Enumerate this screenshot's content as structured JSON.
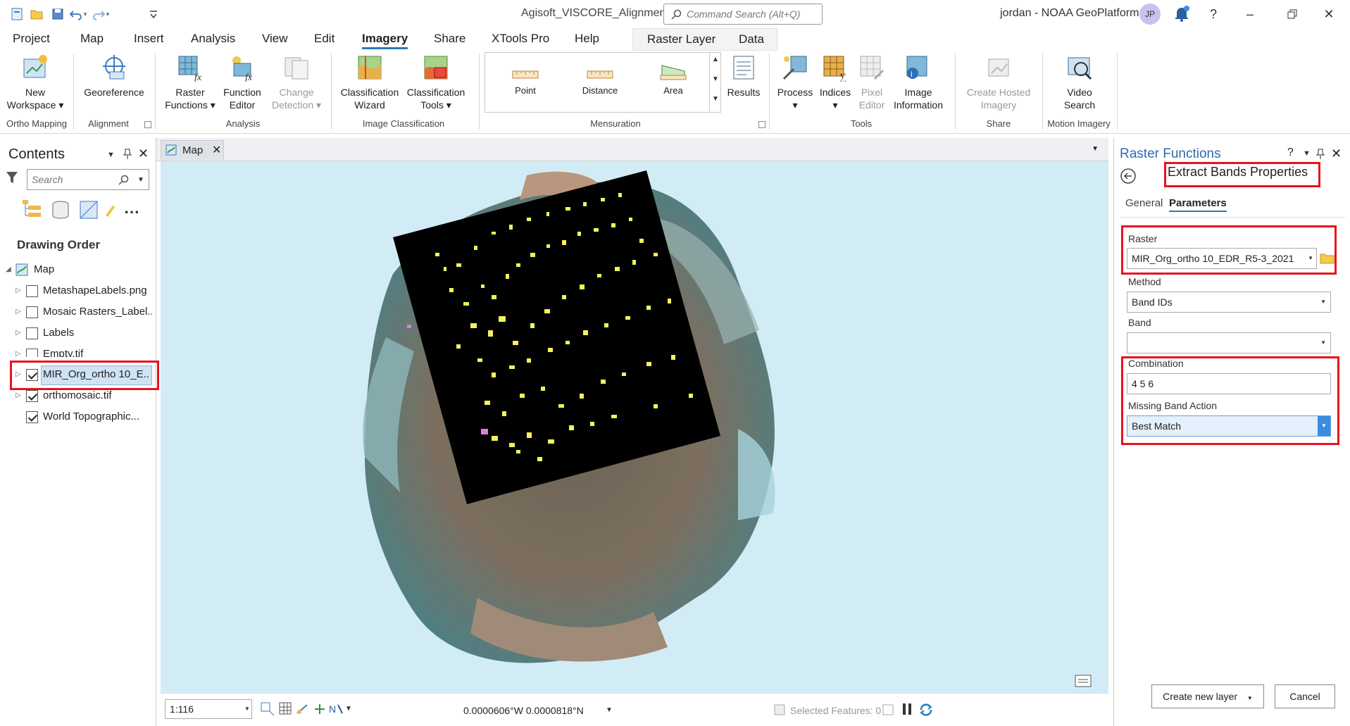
{
  "titlebar": {
    "app_title": "Agisoft_VISCORE_Alignment",
    "command_search_placeholder": "Command Search (Alt+Q)",
    "user": "jordan - NOAA GeoPlatform",
    "avatar_initials": "JP"
  },
  "menu_tabs": [
    "Project",
    "Map",
    "Insert",
    "Analysis",
    "View",
    "Edit",
    "Imagery",
    "Share",
    "XTools Pro",
    "Help"
  ],
  "active_tab": "Imagery",
  "context_tabs": [
    "Raster Layer",
    "Data"
  ],
  "ribbon": {
    "groups": {
      "ortho": "Ortho Mapping",
      "alignment": "Alignment",
      "analysis": "Analysis",
      "image_classification": "Image Classification",
      "mensuration": "Mensuration",
      "tools": "Tools",
      "share": "Share",
      "motion": "Motion Imagery"
    },
    "buttons": {
      "new_workspace": [
        "New",
        "Workspace ▾"
      ],
      "georeference": [
        "Georeference"
      ],
      "raster_functions": [
        "Raster",
        "Functions ▾"
      ],
      "function_editor": [
        "Function",
        "Editor"
      ],
      "change_detection": [
        "Change",
        "Detection ▾"
      ],
      "classification_wizard": [
        "Classification",
        "Wizard"
      ],
      "classification_tools": [
        "Classification",
        "Tools ▾"
      ],
      "results": [
        "Results"
      ],
      "process": [
        "Process",
        "▾"
      ],
      "indices": [
        "Indices",
        "▾"
      ],
      "pixel_editor": [
        "Pixel",
        "Editor"
      ],
      "image_information": [
        "Image",
        "Information"
      ],
      "create_hosted_imagery": [
        "Create Hosted",
        "Imagery"
      ],
      "video_search": [
        "Video",
        "Search"
      ]
    },
    "mensuration_gallery": [
      "Point",
      "Distance",
      "Area"
    ]
  },
  "contents": {
    "title": "Contents",
    "search_placeholder": "Search",
    "drawing_order": "Drawing Order",
    "map_label": "Map",
    "layers": [
      {
        "name": "MetashapeLabels.png",
        "checked": false
      },
      {
        "name": "Mosaic Rasters_Label...",
        "checked": false
      },
      {
        "name": "Labels",
        "checked": false
      },
      {
        "name": "Empty.tif",
        "checked": false
      },
      {
        "name": "MIR_Org_ortho 10_E...",
        "checked": true
      },
      {
        "name": "orthomosaic.tif",
        "checked": true
      },
      {
        "name": "World Topographic...",
        "checked": true
      }
    ]
  },
  "map": {
    "tab_label": "Map",
    "scale": "1:116",
    "coordinates": "0.0000606°W 0.0000818°N",
    "selected_features": "Selected Features: 0"
  },
  "raster_functions": {
    "pane_title": "Raster Functions",
    "properties_title": "Extract Bands Properties",
    "tabs": [
      "General",
      "Parameters"
    ],
    "active_tab": "Parameters",
    "raster_label": "Raster",
    "raster_value": "MIR_Org_ortho 10_EDR_R5-3_2021",
    "method_label": "Method",
    "method_value": "Band IDs",
    "band_label": "Band",
    "band_value": "",
    "combination_label": "Combination",
    "combination_value": "4 5 6",
    "missing_label": "Missing Band Action",
    "missing_value": "Best Match",
    "create_button": "Create new layer",
    "cancel_button": "Cancel"
  },
  "colors": {
    "accent": "#2a7ab8",
    "highlight": "#e8131c",
    "map_bg": "#d2ecf6",
    "raster_black": "#000000",
    "classified": "#f5f25a"
  }
}
